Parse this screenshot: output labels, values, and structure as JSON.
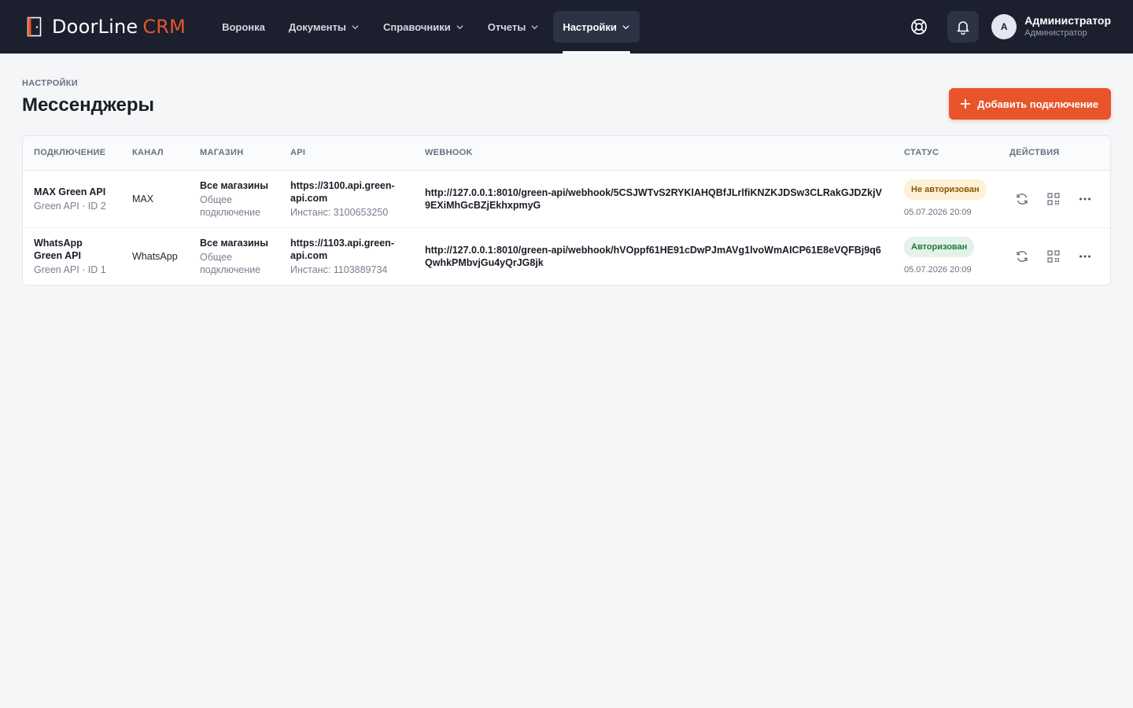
{
  "brand": {
    "name": "DoorLine",
    "accent": "CRM"
  },
  "nav": {
    "items": [
      {
        "label": "Воронка",
        "has_menu": false
      },
      {
        "label": "Документы",
        "has_menu": true
      },
      {
        "label": "Справочники",
        "has_menu": true
      },
      {
        "label": "Отчеты",
        "has_menu": true
      },
      {
        "label": "Настройки",
        "has_menu": true,
        "active": true
      }
    ]
  },
  "user": {
    "avatar_letter": "A",
    "name": "Администратор",
    "role": "Администратор"
  },
  "page": {
    "breadcrumb": "НАСТРОЙКИ",
    "title": "Мессенджеры",
    "add_button": "Добавить подключение"
  },
  "table": {
    "columns": [
      "ПОДКЛЮЧЕНИЕ",
      "КАНАЛ",
      "МАГАЗИН",
      "API",
      "WEBHOOK",
      "СТАТУС",
      "ДЕЙСТВИЯ"
    ],
    "rows": [
      {
        "name": "MAX Green API",
        "meta": "Green API · ID 2",
        "channel": "MAX",
        "store": "Все магазины",
        "store_sub": "Общее подключение",
        "api_url": "https://3100.api.green-api.com",
        "instance": "Инстанс: 3100653250",
        "webhook": "http://127.0.0.1:8010/green-api/webhook/5CSJWTvS2RYKlAHQBfJLrlfiKNZKJDSw3CLRakGJDZkjV9EXiMhGcBZjEkhxpmyG",
        "status": "Не авторизован",
        "status_kind": "warn",
        "status_time": "05.07.2026 20:09"
      },
      {
        "name": "WhatsApp Green API",
        "meta": "Green API · ID 1",
        "channel": "WhatsApp",
        "store": "Все магазины",
        "store_sub": "Общее подключение",
        "api_url": "https://1103.api.green-api.com",
        "instance": "Инстанс: 1103889734",
        "webhook": "http://127.0.0.1:8010/green-api/webhook/hVOppf61HE91cDwPJmAVg1lvoWmAICP61E8eVQFBj9q6QwhkPMbvjGu4yQrJG8jk",
        "status": "Авторизован",
        "status_kind": "ok",
        "status_time": "05.07.2026 20:09"
      }
    ]
  },
  "colors": {
    "topbar": "#1b1f2e",
    "accent": "#e8552a",
    "warn_bg": "#fdf2d6",
    "ok_bg": "#e3f3e9"
  }
}
